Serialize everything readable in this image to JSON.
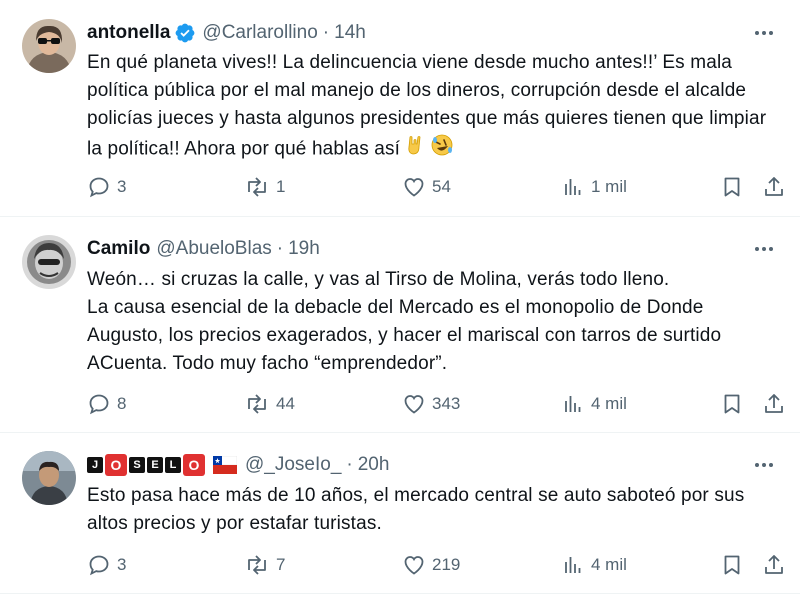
{
  "tweets": [
    {
      "name": "antonella",
      "handle": "@Carlarollino",
      "dot": "·",
      "time": "14h",
      "text": "En qué planeta vives!! La delincuencia viene desde mucho antes!!’ Es mala política pública por el mal manejo de los dineros,  corrupción desde el alcalde policías jueces y hasta algunos presidentes que más quieres tienen que limpiar la política!! Ahora por qué hablas así",
      "emojis": [
        "metal-hand",
        "rolling-laugh"
      ],
      "replies": "3",
      "retweets": "1",
      "likes": "54",
      "views": "1 mil"
    },
    {
      "name": "Camilo",
      "handle": "@AbueloBlas",
      "dot": "·",
      "time": "19h",
      "text": "Weón… si cruzas la calle, y vas al Tirso de Molina, verás todo lleno.\nLa causa esencial de la debacle del Mercado es el monopolio de Donde Augusto, los precios exagerados, y hacer el mariscal con tarros de surtido ACuenta. Todo muy facho “emprendedor”.",
      "replies": "8",
      "retweets": "44",
      "likes": "343",
      "views": "4 mil"
    },
    {
      "name_letters": [
        "J",
        "O",
        "S",
        "E",
        "L",
        "O"
      ],
      "handle": "@_JoseIo_",
      "dot": "·",
      "time": "20h",
      "text": "Esto pasa hace más de 10 años, el mercado central se auto saboteó por sus altos precios y por estafar turistas.",
      "replies": "3",
      "retweets": "7",
      "likes": "219",
      "views": "4 mil"
    }
  ],
  "colors": {
    "text": "#0f1419",
    "secondary": "#536471",
    "verified": "#1d9bf0",
    "divider": "#eff3f4"
  }
}
